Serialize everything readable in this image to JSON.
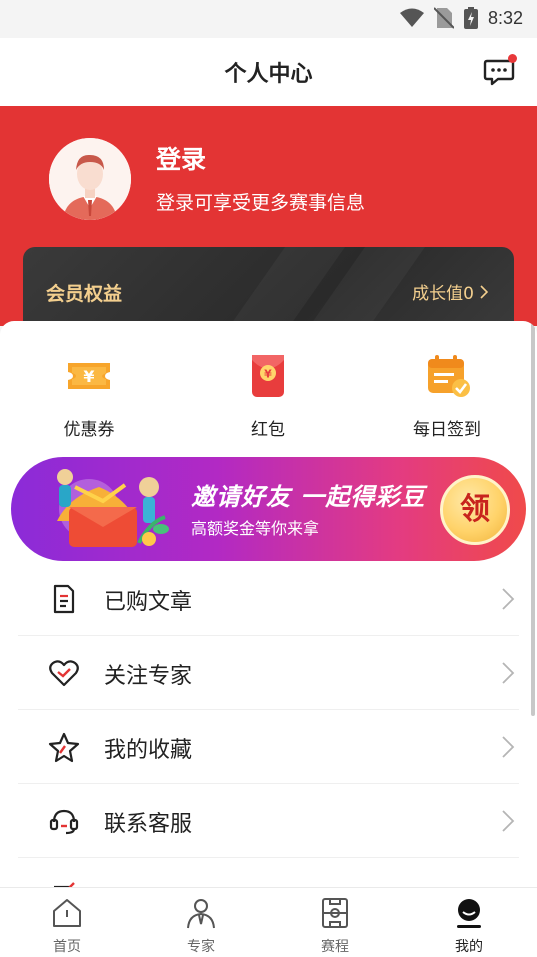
{
  "status_bar": {
    "time": "8:32"
  },
  "nav": {
    "title": "个人中心"
  },
  "profile": {
    "login_label": "登录",
    "login_subtitle": "登录可享受更多赛事信息"
  },
  "vip": {
    "title": "会员权益",
    "growth_label": "成长值0"
  },
  "quick_actions": [
    {
      "label": "优惠券",
      "icon": "coupon-icon"
    },
    {
      "label": "红包",
      "icon": "red-packet-icon"
    },
    {
      "label": "每日签到",
      "icon": "daily-checkin-icon"
    }
  ],
  "banner": {
    "title": "邀请好友 一起得彩豆",
    "subtitle": "高额奖金等你来拿",
    "button_label": "领"
  },
  "menu": [
    {
      "label": "已购文章",
      "icon": "document-icon"
    },
    {
      "label": "关注专家",
      "icon": "heart-icon"
    },
    {
      "label": "我的收藏",
      "icon": "star-icon"
    },
    {
      "label": "联系客服",
      "icon": "headset-icon"
    }
  ],
  "tabs": [
    {
      "label": "首页",
      "icon": "home-icon"
    },
    {
      "label": "专家",
      "icon": "expert-icon"
    },
    {
      "label": "赛程",
      "icon": "schedule-icon"
    },
    {
      "label": "我的",
      "icon": "profile-icon"
    }
  ],
  "colors": {
    "brand_red": "#e33434",
    "vip_gold": "#f3cf8e",
    "banner_start": "#8b2bd8",
    "banner_end": "#f04a4a"
  }
}
